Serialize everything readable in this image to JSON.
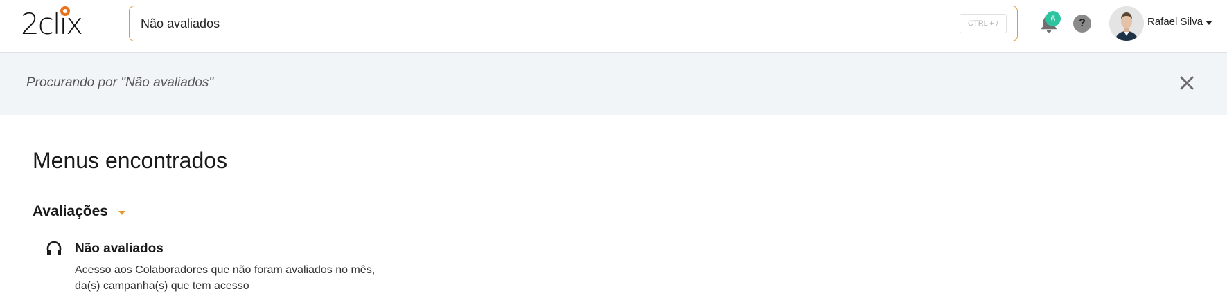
{
  "header": {
    "logo_text": "2clix",
    "search": {
      "value": "Não avaliados",
      "shortcut": "CTRL + /"
    },
    "notifications": {
      "count": "6",
      "icon": "bell-icon"
    },
    "help": {
      "label": "?",
      "icon": "question-icon"
    },
    "user": {
      "name": "Rafael Silva"
    }
  },
  "banner": {
    "text": "Procurando por \"Não avaliados\""
  },
  "results": {
    "section_title": "Menus encontrados",
    "groups": [
      {
        "title": "Avaliações",
        "items": [
          {
            "icon": "headphones-icon",
            "title": "Não avaliados",
            "description": "Acesso aos Colaboradores que não foram avaliados no mês, da(s) campanha(s) que tem acesso"
          }
        ]
      }
    ]
  },
  "colors": {
    "accent": "#e8962f",
    "logo_dot": "#e8731f",
    "badge": "#2ec4a0",
    "banner_bg": "#f1f5f8"
  }
}
